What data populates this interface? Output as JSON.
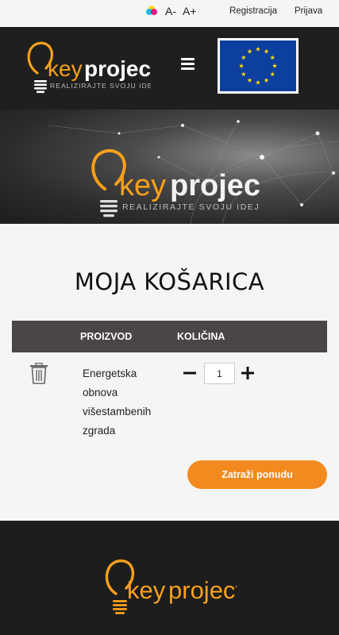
{
  "topbar": {
    "font_decrease": "A-",
    "font_increase": "A+",
    "register_link": "Registracija",
    "login_link": "Prijava"
  },
  "header": {
    "logo_word_key": "key",
    "logo_word_project": "project",
    "logo_tagline": "REALIZIRAJTE SVOJU IDEJU"
  },
  "hero": {
    "logo_word_key": "key",
    "logo_word_project": "project",
    "logo_tagline": "REALIZIRAJTE SVOJU IDEJU"
  },
  "cart": {
    "title": "MOJA KOŠARICA",
    "columns": {
      "product": "PROIZVOD",
      "quantity": "KOLIČINA"
    },
    "items": [
      {
        "product": "Energetska obnova višestambenih zgrada",
        "quantity": "1"
      }
    ],
    "request_quote_label": "Zatraži ponudu"
  },
  "footer": {
    "logo_word_key": "key",
    "logo_word_project": "project"
  },
  "colors": {
    "accent_orange": "#f28a1f",
    "header_dark": "#1f1f1f",
    "table_header": "#4a4645",
    "eu_blue": "#0d3f9f",
    "eu_star": "#ffdd00"
  },
  "icons": [
    "color-palette-icon",
    "hamburger-menu-icon",
    "eu-flag-icon",
    "trash-icon",
    "minus-icon",
    "plus-icon",
    "lightbulb-icon"
  ]
}
